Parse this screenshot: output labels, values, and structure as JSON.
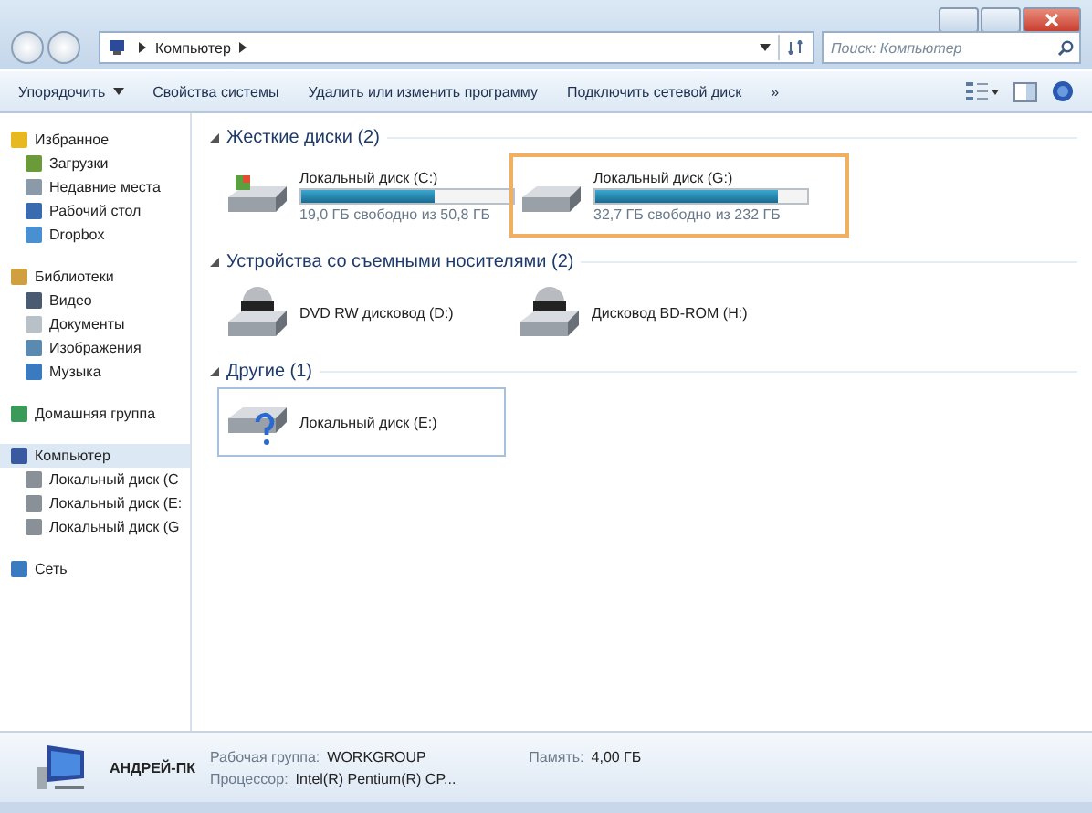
{
  "address_bar": {
    "path": [
      "Компьютер"
    ]
  },
  "search": {
    "placeholder": "Поиск: Компьютер"
  },
  "toolbar": {
    "buttons": [
      {
        "label": "Упорядочить",
        "dropdown": true
      },
      {
        "label": "Свойства системы",
        "dropdown": false
      },
      {
        "label": "Удалить или изменить программу",
        "dropdown": false
      },
      {
        "label": "Подключить сетевой диск",
        "dropdown": false
      }
    ],
    "more": "»"
  },
  "sidebar": {
    "groups": [
      {
        "label": "Избранное",
        "selected": false,
        "children": [
          {
            "label": "Загрузки"
          },
          {
            "label": "Недавние места"
          },
          {
            "label": "Рабочий стол"
          },
          {
            "label": "Dropbox"
          }
        ]
      },
      {
        "label": "Библиотеки",
        "selected": false,
        "children": [
          {
            "label": "Видео"
          },
          {
            "label": "Документы"
          },
          {
            "label": "Изображения"
          },
          {
            "label": "Музыка"
          }
        ]
      },
      {
        "label": "Домашняя группа",
        "selected": false
      },
      {
        "label": "Компьютер",
        "selected": true,
        "children": [
          {
            "label": "Локальный диск (C"
          },
          {
            "label": "Локальный диск (E:"
          },
          {
            "label": "Локальный диск (G"
          }
        ]
      },
      {
        "label": "Сеть",
        "selected": false
      }
    ]
  },
  "sections": [
    {
      "title": "Жесткие диски (2)",
      "items": [
        {
          "kind": "disk",
          "name": "Локальный диск (C:)",
          "level": 0.63,
          "free": "19,0 ГБ свободно из 50,8 ГБ",
          "selected": false,
          "focused": false,
          "windows": true
        },
        {
          "kind": "disk",
          "name": "Локальный диск (G:)",
          "level": 0.86,
          "free": "32,7 ГБ свободно из 232 ГБ",
          "selected": true,
          "focused": false,
          "windows": false
        }
      ]
    },
    {
      "title": "Устройства со съемными носителями (2)",
      "items": [
        {
          "kind": "optical",
          "name": "DVD RW дисковод (D:)",
          "selected": false,
          "focused": false
        },
        {
          "kind": "optical",
          "name": "Дисковод BD-ROM (H:)",
          "selected": false,
          "focused": false
        }
      ]
    },
    {
      "title": "Другие (1)",
      "items": [
        {
          "kind": "unknown",
          "name": "Локальный диск (E:)",
          "selected": false,
          "focused": true
        }
      ]
    }
  ],
  "details": {
    "computer_name": "АНДРЕЙ-ПК",
    "fields": [
      {
        "label": "Рабочая группа:",
        "value": "WORKGROUP"
      },
      {
        "label": "Память:",
        "value": "4,00 ГБ"
      },
      {
        "label": "Процессор:",
        "value": "Intel(R) Pentium(R) CP..."
      }
    ]
  }
}
